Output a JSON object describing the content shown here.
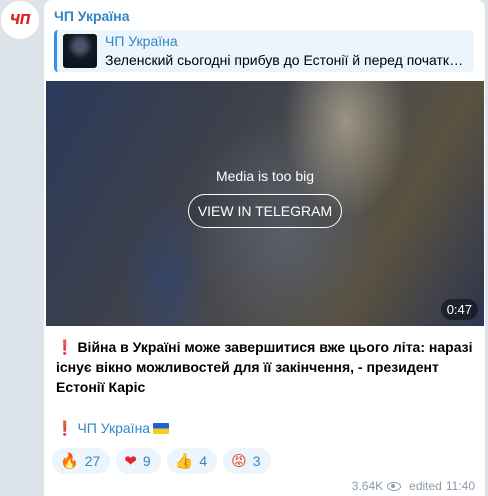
{
  "channel": {
    "avatar_text": "ЧП",
    "name": "ЧП Україна"
  },
  "reply": {
    "title": "ЧП Україна",
    "text": "Зеленский сьогодні прибув до Естонії й перед початком..."
  },
  "media": {
    "message": "Media is too big",
    "button_label": "VIEW IN TELEGRAM",
    "duration": "0:47"
  },
  "post": {
    "excl": "❗",
    "text": "Війна в Україні може завершитися вже цього літа: наразі існує вікно можливостей для її закінчення, - президент Естонії Каріс",
    "signature_excl": "❗",
    "signature_link": "ЧП Україна"
  },
  "reactions": [
    {
      "emoji": "🔥",
      "icon": "fire-icon",
      "count": "27"
    },
    {
      "emoji": "❤",
      "icon": "heart-icon",
      "count": "9"
    },
    {
      "emoji": "👍",
      "icon": "thumbs-up-icon",
      "count": "4"
    },
    {
      "emoji": "😡",
      "icon": "angry-face-icon",
      "count": "3"
    }
  ],
  "meta": {
    "views": "3.64K",
    "edited": "edited",
    "time": "11:40"
  },
  "colors": {
    "accent": "#2f87c7",
    "background": "#dce3ea",
    "bubble": "#ffffff"
  }
}
